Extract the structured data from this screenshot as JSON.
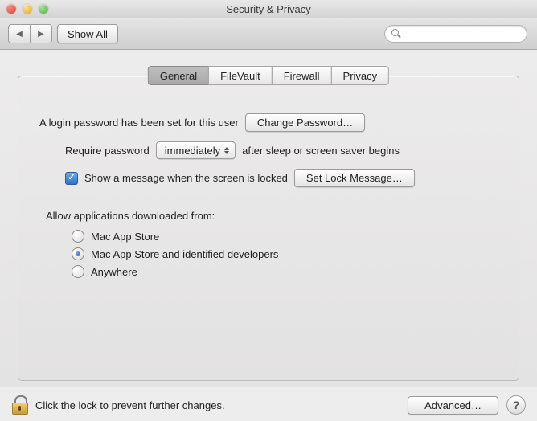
{
  "window": {
    "title": "Security & Privacy"
  },
  "toolbar": {
    "back_label": "◀",
    "forward_label": "▶",
    "show_all_label": "Show All",
    "search_placeholder": ""
  },
  "tabs": [
    {
      "label": "General",
      "active": true
    },
    {
      "label": "FileVault",
      "active": false
    },
    {
      "label": "Firewall",
      "active": false
    },
    {
      "label": "Privacy",
      "active": false
    }
  ],
  "general": {
    "login_password_text": "A login password has been set for this user",
    "change_password_label": "Change Password…",
    "require_password_prefix": "Require password",
    "require_password_delay": "immediately",
    "require_password_suffix": "after sleep or screen saver begins",
    "show_message_checked": true,
    "show_message_label": "Show a message when the screen is locked",
    "set_lock_message_label": "Set Lock Message…",
    "allow_apps_heading": "Allow applications downloaded from:",
    "allow_options": [
      {
        "label": "Mac App Store",
        "selected": false
      },
      {
        "label": "Mac App Store and identified developers",
        "selected": true
      },
      {
        "label": "Anywhere",
        "selected": false
      }
    ]
  },
  "footer": {
    "lock_text": "Click the lock to prevent further changes.",
    "advanced_label": "Advanced…",
    "help_label": "?"
  }
}
